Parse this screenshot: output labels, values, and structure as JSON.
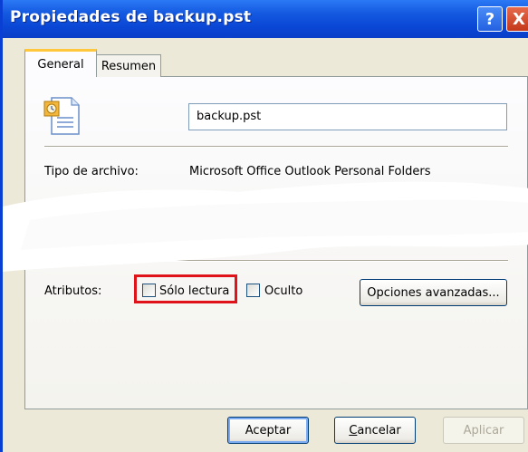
{
  "window": {
    "title": "Propiedades de backup.pst",
    "help_glyph": "?",
    "close_glyph": "X"
  },
  "tabs": [
    {
      "label": "General",
      "selected": true
    },
    {
      "label": "Resumen",
      "selected": false
    }
  ],
  "general": {
    "file_icon": "outlook-pst-file-icon",
    "filename": "backup.pst",
    "type_label": "Tipo de archivo:",
    "type_value": "Microsoft Office Outlook Personal Folders",
    "attributes_label": "Atributos:",
    "readonly_label": "Sólo lectura",
    "hidden_label": "Oculto",
    "advanced_button": "Opciones avanzadas..."
  },
  "buttons": {
    "ok": "Aceptar",
    "cancel_prefix": "",
    "cancel_hot": "C",
    "cancel_rest": "ancelar",
    "apply": "Aplicar"
  },
  "colors": {
    "title_bar": "#0a47d5",
    "highlight": "#e0121a",
    "tab_hot": "#ffc83c"
  }
}
